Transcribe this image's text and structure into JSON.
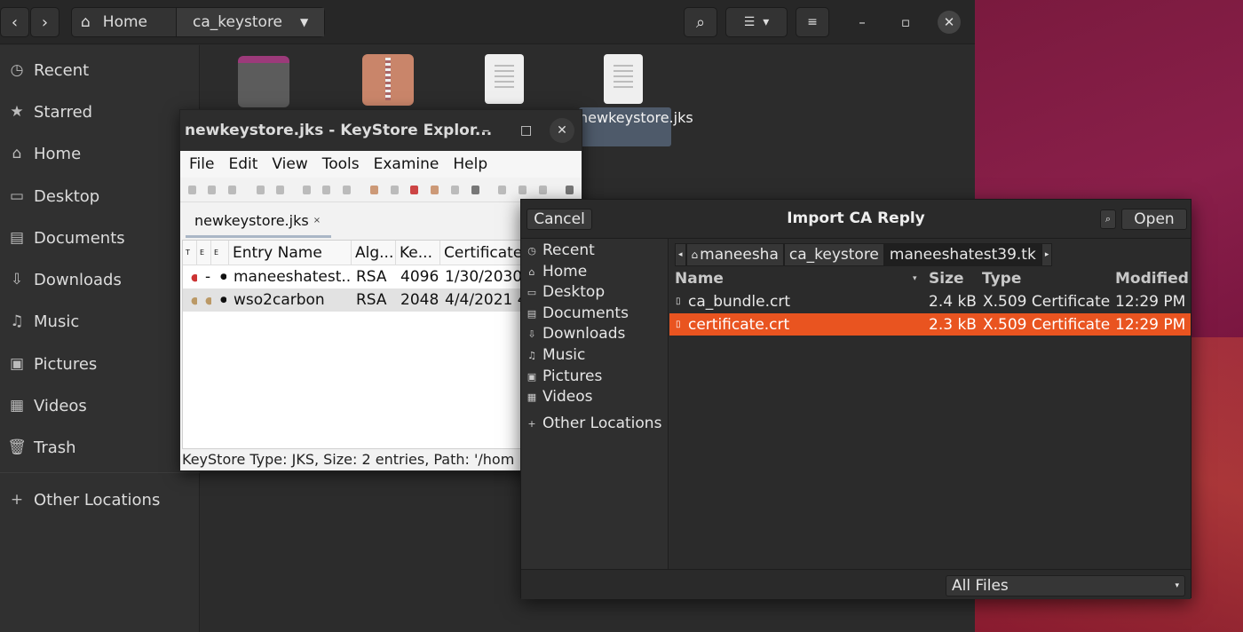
{
  "files": {
    "breadcrumb": {
      "home": "Home",
      "current": "ca_keystore"
    },
    "sidebar": [
      {
        "label": "Recent",
        "icon": "clock-icon"
      },
      {
        "label": "Starred",
        "icon": "star-icon"
      },
      {
        "label": "Home",
        "icon": "home-icon"
      },
      {
        "label": "Desktop",
        "icon": "desktop-icon"
      },
      {
        "label": "Documents",
        "icon": "document-icon"
      },
      {
        "label": "Downloads",
        "icon": "download-icon"
      },
      {
        "label": "Music",
        "icon": "music-icon"
      },
      {
        "label": "Pictures",
        "icon": "picture-icon"
      },
      {
        "label": "Videos",
        "icon": "video-icon"
      },
      {
        "label": "Trash",
        "icon": "trash-icon"
      },
      {
        "label": "Other Locations",
        "icon": "plus-icon"
      }
    ],
    "file_label": "newkeystore.jks"
  },
  "kse": {
    "title": "newkeystore.jks - KeyStore Explor...",
    "menu": [
      "File",
      "Edit",
      "View",
      "Tools",
      "Examine",
      "Help"
    ],
    "tab": "newkeystore.jks",
    "columns": [
      "T",
      "E",
      "E",
      "Entry Name",
      "Alg...",
      "Ke...",
      "Certificate"
    ],
    "rows": [
      {
        "name": "maneeshatest...",
        "alg": "RSA",
        "key": "4096",
        "cert": "1/30/2030 5"
      },
      {
        "name": "wso2carbon",
        "alg": "RSA",
        "key": "2048",
        "cert": "4/4/2021 4:"
      }
    ],
    "status": "KeyStore Type: JKS, Size: 2 entries, Path: '/hom"
  },
  "dialog": {
    "title": "Import CA Reply",
    "cancel": "Cancel",
    "open": "Open",
    "places": [
      "Recent",
      "Home",
      "Desktop",
      "Documents",
      "Downloads",
      "Music",
      "Pictures",
      "Videos",
      "Other Locations"
    ],
    "path": [
      "maneesha",
      "ca_keystore",
      "maneeshatest39.tk"
    ],
    "columns": {
      "name": "Name",
      "size": "Size",
      "type": "Type",
      "modified": "Modified"
    },
    "files": [
      {
        "name": "ca_bundle.crt",
        "size": "2.4 kB",
        "type": "X.509 Certificate",
        "modified": "12:29 PM"
      },
      {
        "name": "certificate.crt",
        "size": "2.3 kB",
        "type": "X.509 Certificate",
        "modified": "12:29 PM"
      }
    ],
    "filter": "All Files",
    "accent": "#e95420"
  }
}
